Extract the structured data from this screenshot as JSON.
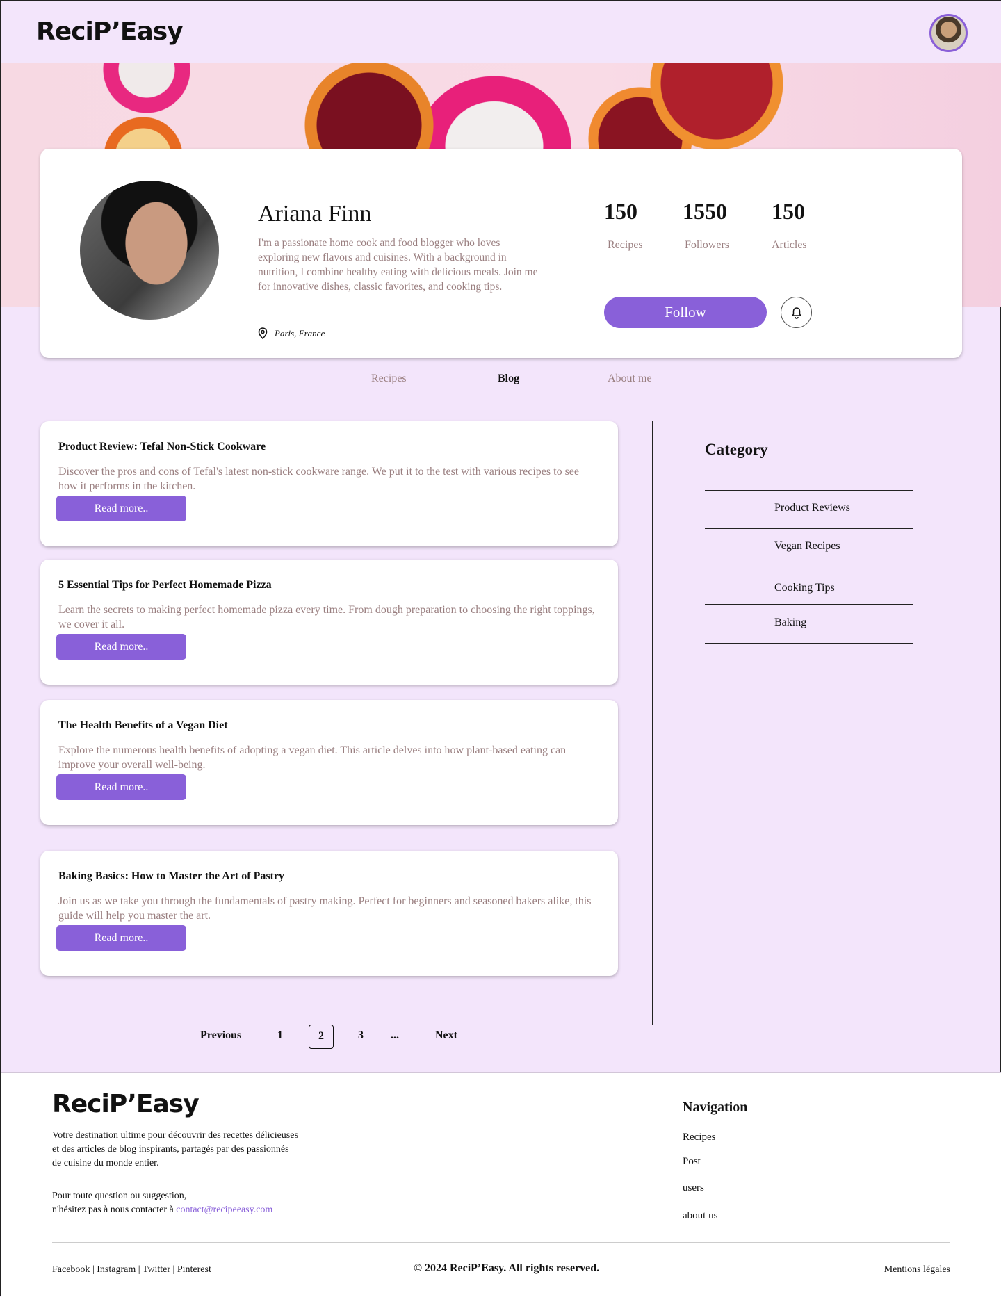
{
  "header": {
    "logo": "ReciP’Easy",
    "avatar_icon": "user-avatar"
  },
  "profile": {
    "name": "Ariana Finn",
    "bio": "I'm a passionate home cook and food blogger who loves exploring new flavors and cuisines. With a background in nutrition, I combine healthy eating with delicious meals. Join me for innovative dishes, classic favorites, and cooking tips.",
    "location": "Paris, France",
    "stats": [
      {
        "value": "150",
        "label": "Recipes"
      },
      {
        "value": "1550",
        "label": "Followers"
      },
      {
        "value": "150",
        "label": "Articles"
      }
    ],
    "follow_label": "Follow"
  },
  "tabs": [
    {
      "label": "Recipes"
    },
    {
      "label": "Blog",
      "active": true
    },
    {
      "label": "About me"
    }
  ],
  "posts": [
    {
      "title": "Product Review: Tefal Non-Stick Cookware",
      "desc": "Discover the pros and cons of Tefal's latest non-stick cookware range. We put it to the test with various recipes to see how it performs in the kitchen.",
      "button": "Read more.."
    },
    {
      "title": "5 Essential Tips for Perfect Homemade Pizza",
      "desc": "Learn the secrets to making perfect homemade pizza every time. From dough preparation to choosing the right toppings, we cover it all.",
      "button": "Read more.."
    },
    {
      "title": "The Health Benefits of a Vegan Diet",
      "desc": "Explore the numerous health benefits of adopting a vegan diet. This article delves into how plant-based eating can improve your overall well-being.",
      "button": "Read more.."
    },
    {
      "title": "Baking Basics: How to Master the Art of Pastry",
      "desc": "Join us as we take you through the fundamentals of pastry making. Perfect for beginners and seasoned bakers alike, this guide will help you master the art.",
      "button": "Read more.."
    }
  ],
  "category": {
    "title": "Category",
    "items": [
      "Product Reviews",
      "Vegan Recipes",
      "Cooking Tips",
      "Baking"
    ]
  },
  "pagination": {
    "previous": "Previous",
    "pages": [
      "1",
      "2",
      "3",
      "..."
    ],
    "current": "2",
    "next": "Next"
  },
  "footer": {
    "logo": "ReciP’Easy",
    "desc1": "Votre destination ultime pour découvrir des recettes délicieuses",
    "desc2": "et des articles de blog inspirants, partagés par des passionnés",
    "desc3": "de cuisine du monde entier.",
    "contact1": "Pour toute question ou suggestion,",
    "contact2": "n'hésitez pas à nous contacter à ",
    "email": "contact@recipeeasy.com",
    "nav_title": "Navigation",
    "nav": [
      "Recipes",
      "Post",
      "users",
      "about us"
    ],
    "social": [
      "Facebook",
      "Instagram",
      "Twitter",
      "Pinterest"
    ],
    "copyright": "© 2024 ReciP’Easy. All rights reserved.",
    "legal": "Mentions légales"
  },
  "colors": {
    "accent": "#8960d9",
    "background": "#f3e5fb",
    "muted": "#9a7f80"
  }
}
